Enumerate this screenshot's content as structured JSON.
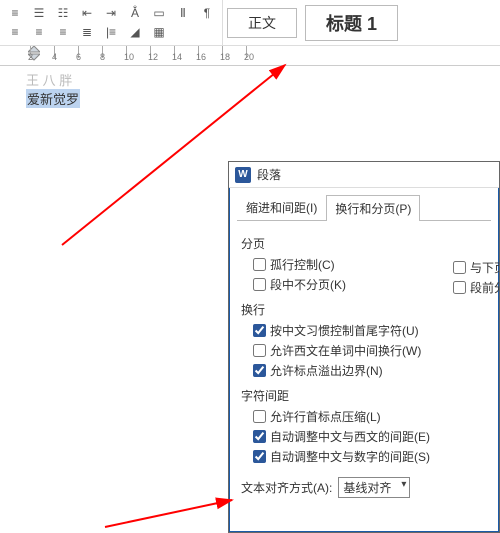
{
  "toolbar": {
    "style_normal": "正文",
    "style_h1": "标题 1"
  },
  "ruler": {
    "ticks": [
      "2",
      "2",
      "4",
      "6",
      "8",
      "10",
      "12",
      "14",
      "16",
      "18",
      "20"
    ]
  },
  "document": {
    "line1": "王 八 胖",
    "line2_sel": "爱新觉罗"
  },
  "dialog": {
    "title": "段落",
    "tabs": {
      "t1": "缩进和间距(I)",
      "t2": "换行和分页(P)"
    },
    "sec_page": "分页",
    "cb_orphan": "孤行控制(C)",
    "cb_withnext": "与下页",
    "cb_keep": "段中不分页(K)",
    "cb_before": "段前分",
    "sec_wrap": "换行",
    "cb_cjk": "按中文习惯控制首尾字符(U)",
    "cb_latinwrap": "允许西文在单词中间换行(W)",
    "cb_punct": "允许标点溢出边界(N)",
    "sec_spacing": "字符间距",
    "cb_compress": "允许行首标点压缩(L)",
    "cb_cjklatin": "自动调整中文与西文的间距(E)",
    "cb_cjknum": "自动调整中文与数字的间距(S)",
    "align_label": "文本对齐方式(A):",
    "align_value": "基线对齐"
  }
}
